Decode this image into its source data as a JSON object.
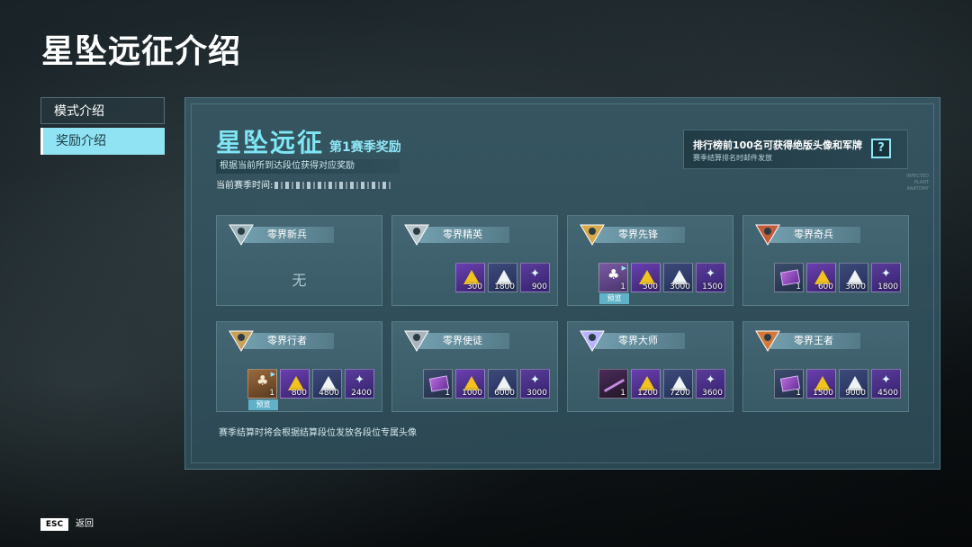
{
  "title": "星坠远征介绍",
  "nav": [
    {
      "label": "模式介绍",
      "active": false
    },
    {
      "label": "奖励介绍",
      "active": true
    }
  ],
  "panel": {
    "heading": "星坠远征",
    "season_label": "第1赛季奖励",
    "description": "根据当前所到达段位获得对应奖励",
    "season_time_label": "当前赛季时间:",
    "leaderboard": {
      "title": "排行榜前100名可获得绝版头像和军牌",
      "subtitle": "赛季结算排名时邮件发放",
      "help_icon": "?"
    },
    "deco_text": [
      "INFECTED",
      "PLANT",
      "ANATOMY"
    ],
    "footnote": "赛季结算时将会根据结算段位发放各段位专属头像"
  },
  "tiers": [
    {
      "name": "零界新兵",
      "none_text": "无",
      "items": []
    },
    {
      "name": "零界精英",
      "items": [
        {
          "type": "tri",
          "qty": "300"
        },
        {
          "type": "wtri",
          "qty": "1800"
        },
        {
          "type": "wing",
          "qty": "900"
        }
      ]
    },
    {
      "name": "零界先锋",
      "items": [
        {
          "type": "skin",
          "qty": "1",
          "preview": "预览"
        },
        {
          "type": "tri",
          "qty": "500"
        },
        {
          "type": "wtri",
          "qty": "3000"
        },
        {
          "type": "wing",
          "qty": "1500"
        }
      ]
    },
    {
      "name": "零界奇兵",
      "items": [
        {
          "type": "card-i",
          "qty": "1"
        },
        {
          "type": "tri",
          "qty": "600"
        },
        {
          "type": "wtri",
          "qty": "3600"
        },
        {
          "type": "wing",
          "qty": "1800"
        }
      ]
    },
    {
      "name": "零界行者",
      "items": [
        {
          "type": "skin2",
          "qty": "1",
          "preview": "预览"
        },
        {
          "type": "tri",
          "qty": "800"
        },
        {
          "type": "wtri",
          "qty": "4800"
        },
        {
          "type": "wing",
          "qty": "2400"
        }
      ]
    },
    {
      "name": "零界使徒",
      "items": [
        {
          "type": "card-i",
          "qty": "1"
        },
        {
          "type": "tri",
          "qty": "1000"
        },
        {
          "type": "wtri",
          "qty": "6000"
        },
        {
          "type": "wing",
          "qty": "3000"
        }
      ]
    },
    {
      "name": "零界大师",
      "items": [
        {
          "type": "blade",
          "qty": "1"
        },
        {
          "type": "tri",
          "qty": "1200"
        },
        {
          "type": "wtri",
          "qty": "7200"
        },
        {
          "type": "wing",
          "qty": "3600"
        }
      ]
    },
    {
      "name": "零界王者",
      "items": [
        {
          "type": "card-i",
          "qty": "1"
        },
        {
          "type": "tri",
          "qty": "1500"
        },
        {
          "type": "wtri",
          "qty": "9000"
        },
        {
          "type": "wing",
          "qty": "4500"
        }
      ]
    }
  ],
  "footer": {
    "esc_key": "ESC",
    "back_label": "返回"
  },
  "colors": {
    "accent": "#8fe3f2",
    "gold": "#f2c21d",
    "panel": "#3a6272"
  }
}
